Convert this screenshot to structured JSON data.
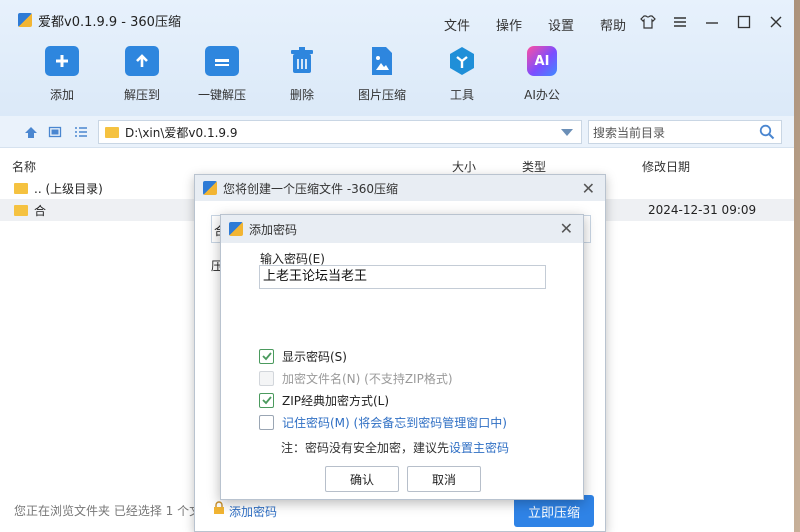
{
  "app": {
    "title": "爱都v0.1.9.9 - 360压缩"
  },
  "menu": [
    "文件",
    "操作",
    "设置",
    "帮助"
  ],
  "toolbar": [
    {
      "label": "添加",
      "icon": "add-icon",
      "color": "#2e86de"
    },
    {
      "label": "解压到",
      "icon": "extract-to-icon",
      "color": "#2e86de"
    },
    {
      "label": "一键解压",
      "icon": "one-click-extract-icon",
      "color": "#2e86de"
    },
    {
      "label": "删除",
      "icon": "trash-icon",
      "color": "#2e86de"
    },
    {
      "label": "图片压缩",
      "icon": "image-compress-icon",
      "color": "#2e86de"
    },
    {
      "label": "工具",
      "icon": "tools-icon",
      "color": "#1f8fd8"
    },
    {
      "label": "AI办公",
      "icon": "ai-icon",
      "color": "#7c4dff"
    }
  ],
  "address": {
    "path": "D:\\xin\\爱都v0.1.9.9",
    "search_placeholder": "搜索当前目录"
  },
  "columns": {
    "name": "名称",
    "size": "大小",
    "type": "类型",
    "modified": "修改日期"
  },
  "files": [
    {
      "name": ".. (上级目录)",
      "date": ""
    },
    {
      "name": "合",
      "date": "2024-12-31 09:09"
    }
  ],
  "status": "您正在浏览文件夹 已经选择 1 个文",
  "create_dialog": {
    "title": "您将创建一个压缩文件 -360压缩",
    "field_partial": "合",
    "label_partial": "压",
    "add_password_link": "添加密码",
    "compress_button": "立即压缩"
  },
  "password_dialog": {
    "title": "添加密码",
    "input_label": "输入密码(E)",
    "password_value": "上老王论坛当老王",
    "options": [
      {
        "label": "显示密码(S)",
        "checked": true,
        "disabled": false
      },
      {
        "label": "加密文件名(N) (不支持ZIP格式)",
        "checked": false,
        "disabled": true
      },
      {
        "label": "ZIP经典加密方式(L)",
        "checked": true,
        "disabled": false
      },
      {
        "label": "记住密码(M) (将会备忘到密码管理窗口中)",
        "checked": false,
        "disabled": false
      }
    ],
    "note_prefix": "注：密码没有安全加密，建议先",
    "note_link": "设置主密码",
    "ok_button": "确认",
    "cancel_button": "取消"
  },
  "colors": {
    "accent": "#2f83e6",
    "link": "#2f6fc4",
    "check": "#4b9a5e",
    "folder": "#f5c240"
  }
}
